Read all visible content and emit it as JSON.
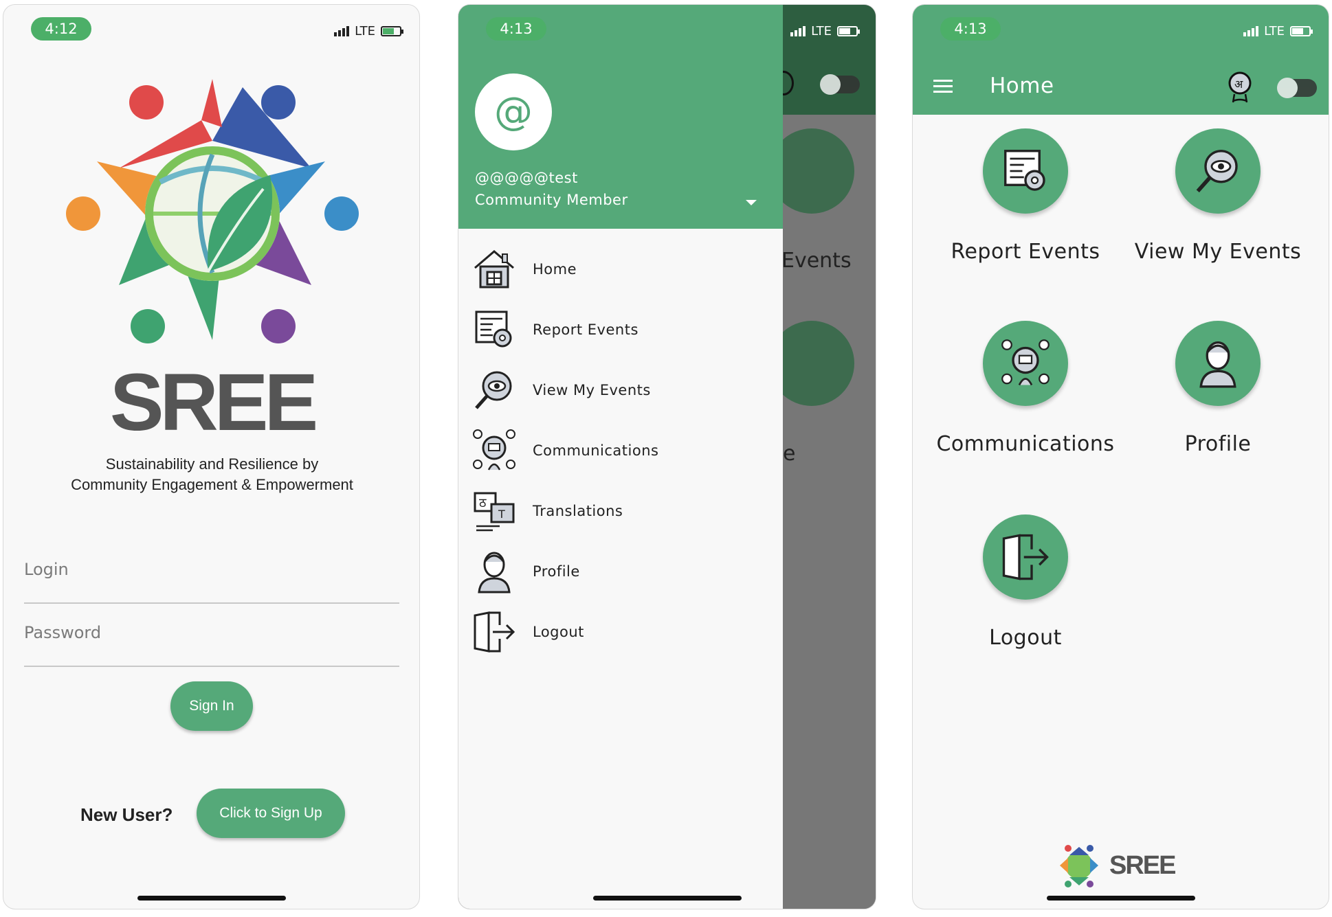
{
  "login_screen": {
    "status_time": "4:12",
    "network": "LTE",
    "brand_name": "SREE",
    "tagline_1": "Sustainability and Resilience by",
    "tagline_2": "Community Engagement & Empowerment",
    "login_placeholder": "Login",
    "password_placeholder": "Password",
    "sign_in_label": "Sign In",
    "new_user_text": "New User?",
    "sign_up_label": "Click to Sign Up"
  },
  "drawer_screen": {
    "status_time": "4:13",
    "network": "LTE",
    "avatar_symbol": "@",
    "username": "@@@@@test",
    "role": "Community Member",
    "menu": [
      {
        "label": "Home",
        "icon": "house-icon"
      },
      {
        "label": "Report Events",
        "icon": "report-events-icon"
      },
      {
        "label": "View My Events",
        "icon": "view-events-icon"
      },
      {
        "label": "Communications",
        "icon": "communications-icon"
      },
      {
        "label": "Translations",
        "icon": "translations-icon"
      },
      {
        "label": "Profile",
        "icon": "profile-icon"
      },
      {
        "label": "Logout",
        "icon": "logout-icon"
      }
    ],
    "background_partial_1": "Events",
    "background_partial_2": "e"
  },
  "home_screen": {
    "status_time": "4:13",
    "network": "LTE",
    "title": "Home",
    "tiles": [
      {
        "label": "Report Events",
        "icon": "report-events-icon"
      },
      {
        "label": "View My Events",
        "icon": "view-events-icon"
      },
      {
        "label": "Communications",
        "icon": "communications-icon"
      },
      {
        "label": "Profile",
        "icon": "profile-icon"
      },
      {
        "label": "Logout",
        "icon": "logout-icon"
      }
    ],
    "footer_brand": "SREE"
  },
  "colors": {
    "primary_green": "#55a979",
    "status_pill_green": "#4caf68",
    "screen_background": "#f8f8f8",
    "scrim": "#777777"
  }
}
